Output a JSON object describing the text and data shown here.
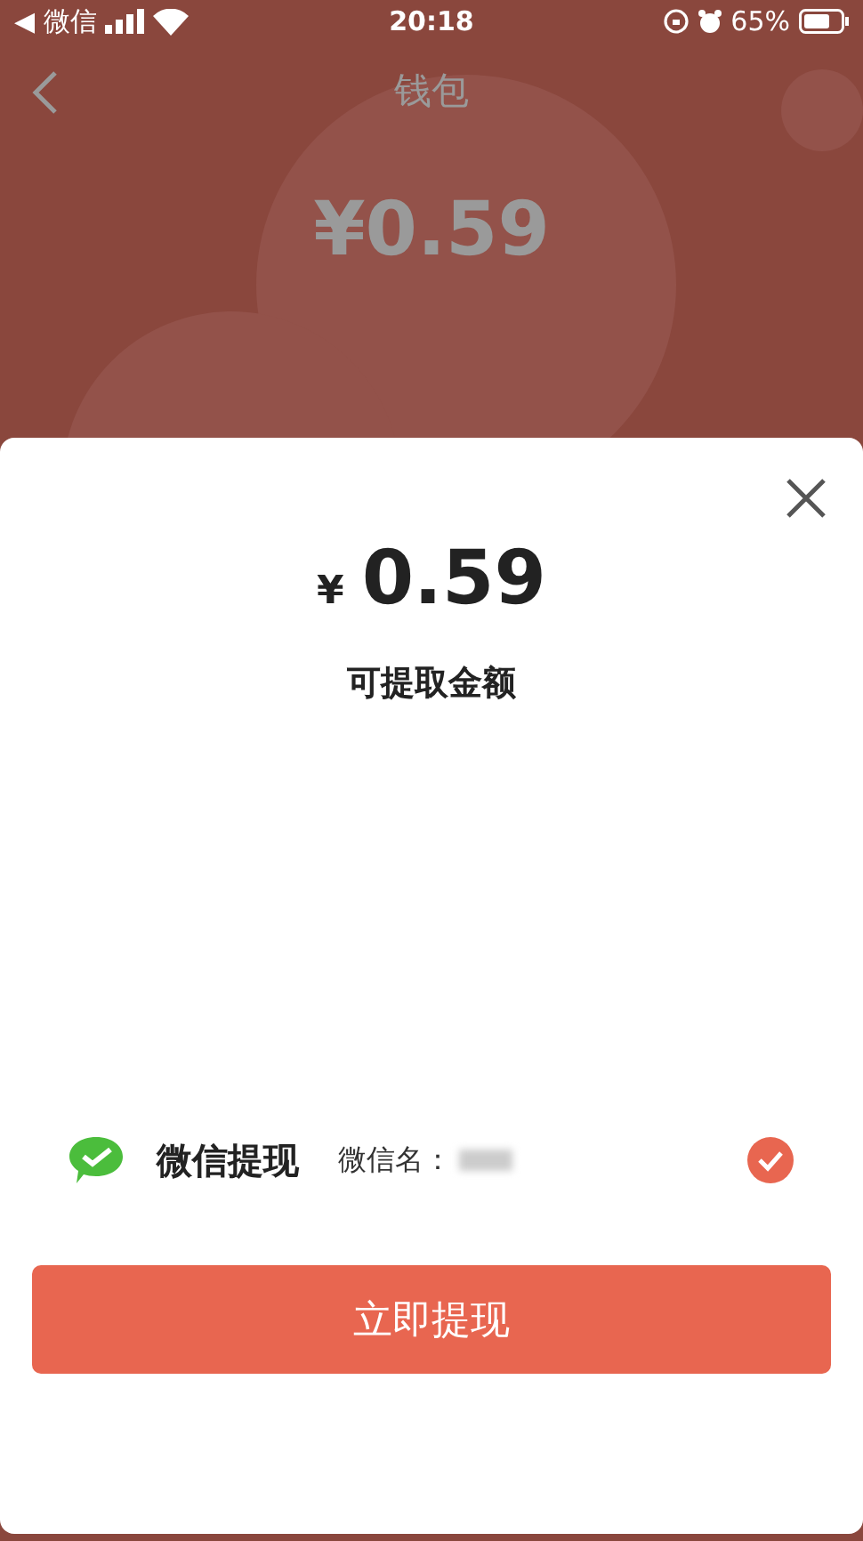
{
  "status_bar": {
    "back_app": "◀ 微信",
    "time": "20:18",
    "battery": "65%"
  },
  "header": {
    "title": "钱包",
    "balance": "¥0.59"
  },
  "sheet": {
    "currency": "¥",
    "amount": "0.59",
    "amount_label": "可提取金额",
    "method": {
      "name": "微信提现",
      "account_label": "微信名：",
      "selected": true
    },
    "submit": "立即提现"
  }
}
